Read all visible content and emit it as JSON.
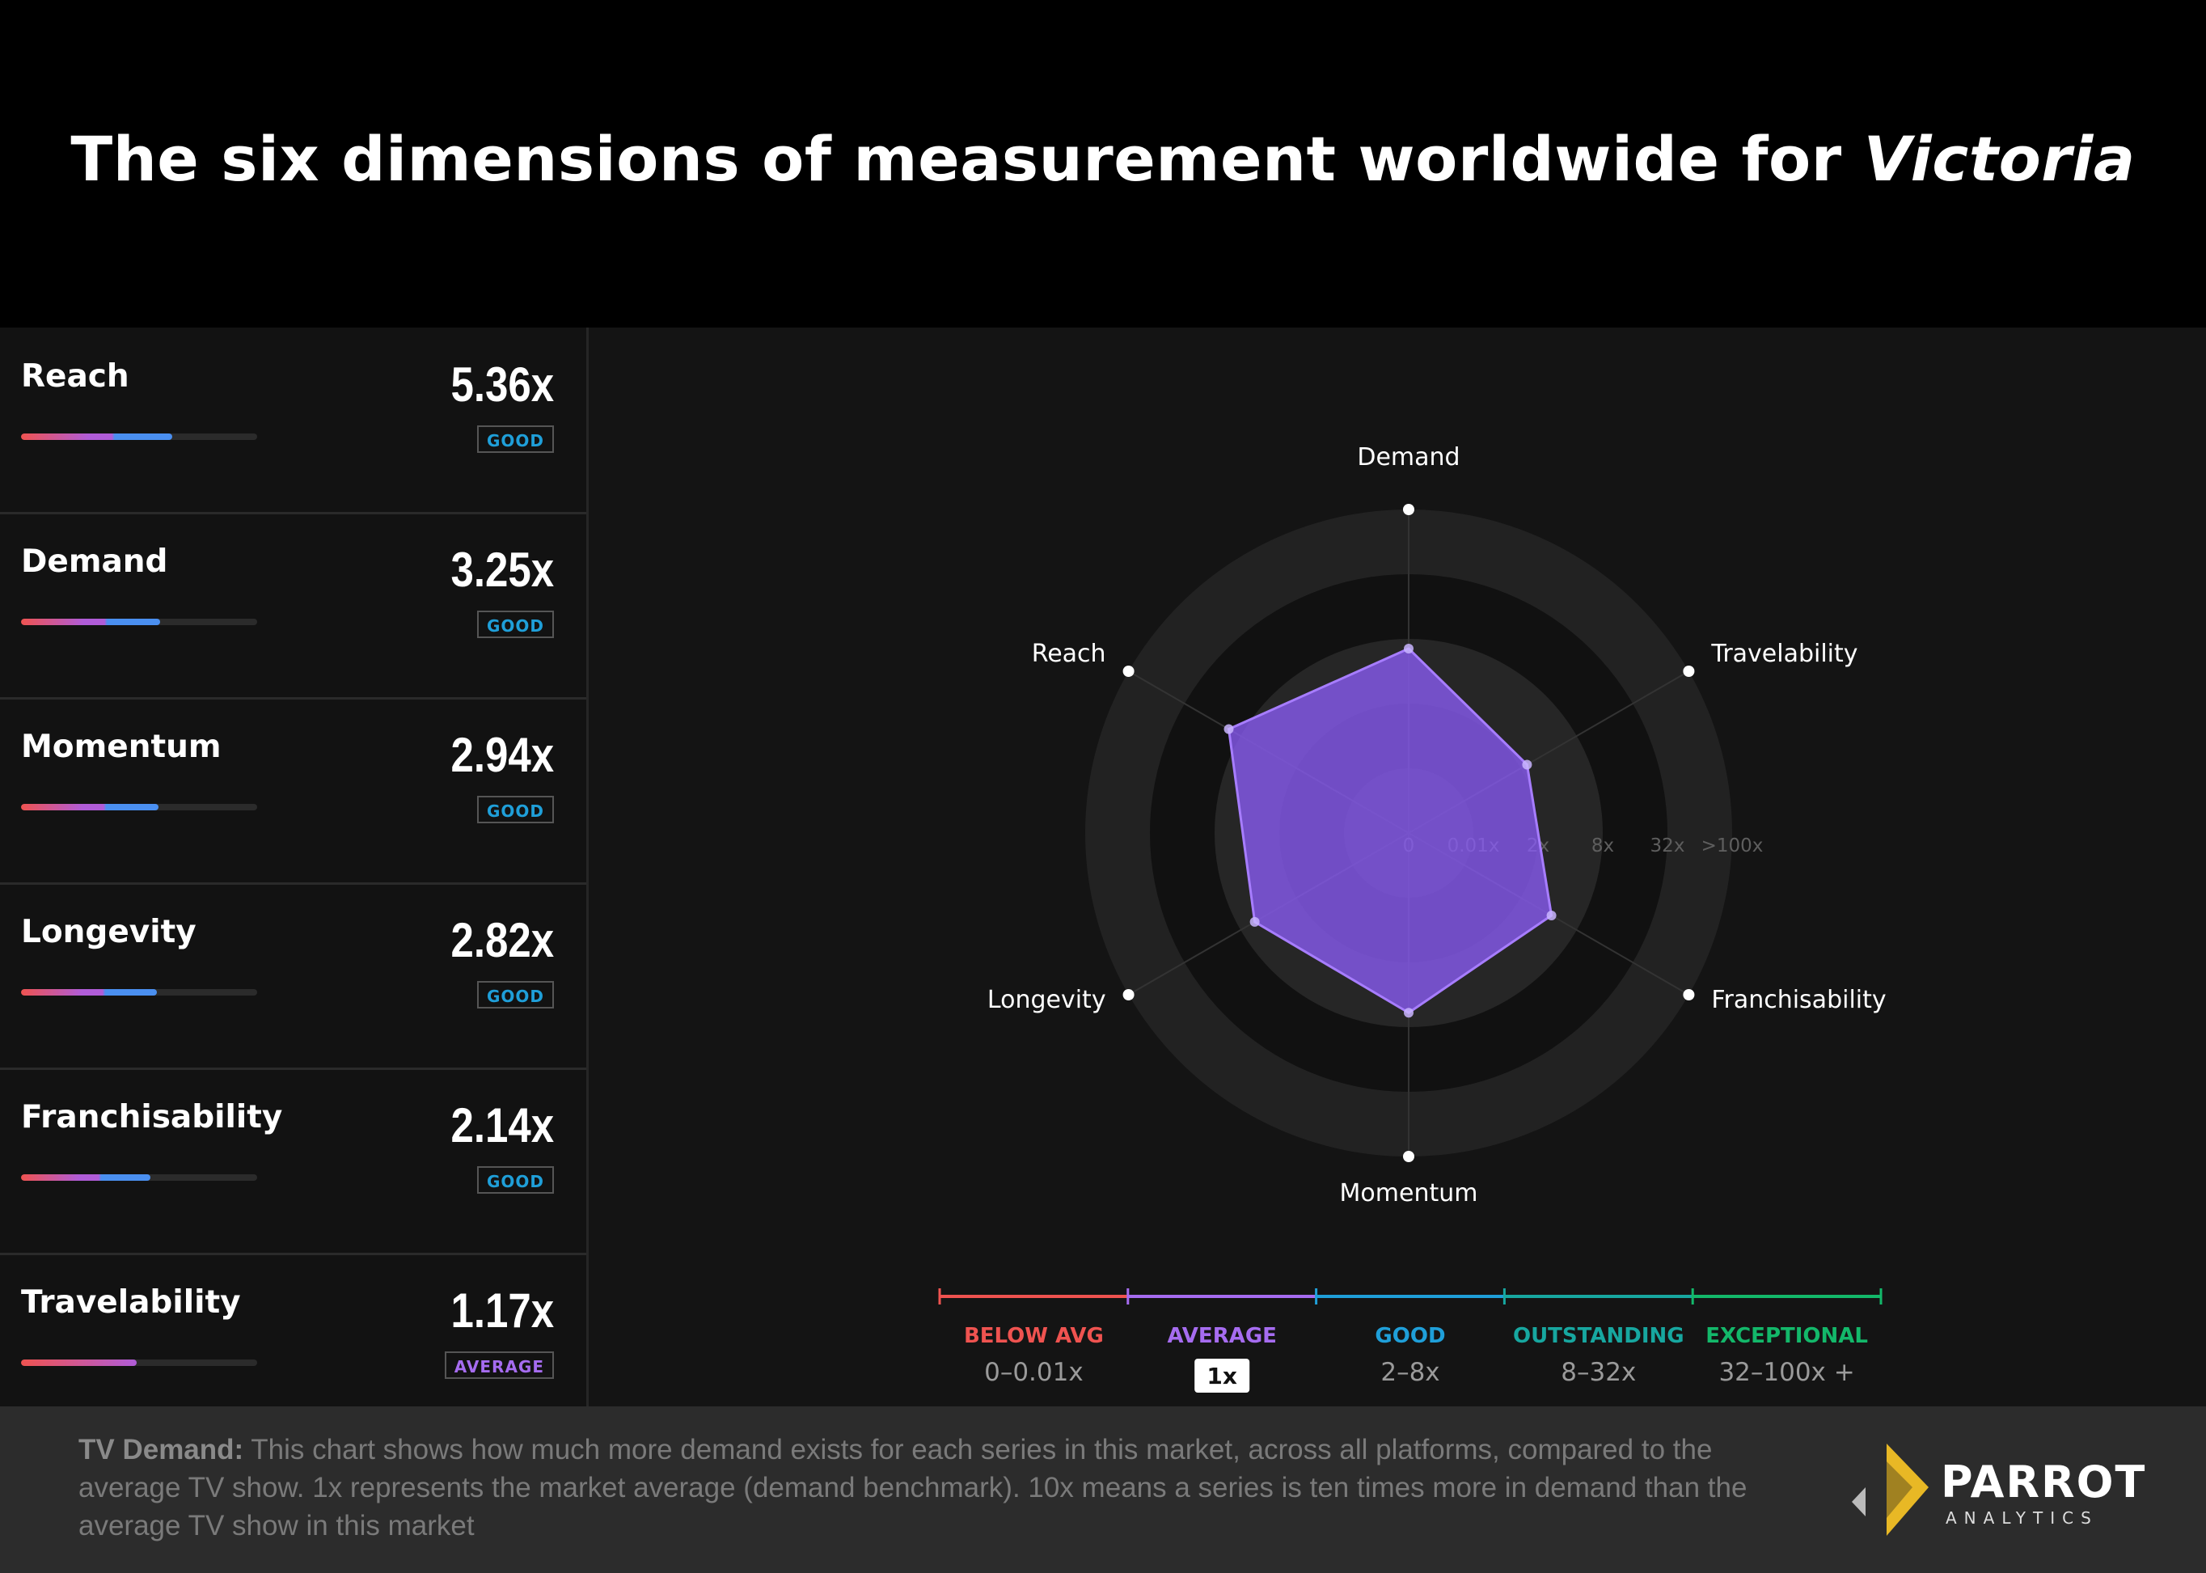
{
  "title": {
    "prefix": "The six dimensions of measurement worldwide for ",
    "show": "Victoria"
  },
  "metrics": [
    {
      "name": "Reach",
      "value": "5.36x",
      "badge": "GOOD"
    },
    {
      "name": "Demand",
      "value": "3.25x",
      "badge": "GOOD"
    },
    {
      "name": "Momentum",
      "value": "2.94x",
      "badge": "GOOD"
    },
    {
      "name": "Longevity",
      "value": "2.82x",
      "badge": "GOOD"
    },
    {
      "name": "Franchisability",
      "value": "2.14x",
      "badge": "GOOD"
    },
    {
      "name": "Travelability",
      "value": "1.17x",
      "badge": "AVERAGE"
    }
  ],
  "chart_data": {
    "type": "radar",
    "axes": [
      "Demand",
      "Travelability",
      "Franchisability",
      "Momentum",
      "Longevity",
      "Reach"
    ],
    "values": [
      3.25,
      1.17,
      2.14,
      2.94,
      2.82,
      5.36
    ],
    "scale_ticks": [
      "0",
      "0.01x",
      "2x",
      "8x",
      "32x",
      ">100x"
    ],
    "scale_type": "log",
    "fill_color": "#8b5cf6",
    "legend": [
      {
        "label": "BELOW AVG",
        "range": "0–0.01x",
        "color": "#ef5350"
      },
      {
        "label": "AVERAGE",
        "range": "1x",
        "color": "#a66cf0"
      },
      {
        "label": "GOOD",
        "range": "2–8x",
        "color": "#1f9fd9"
      },
      {
        "label": "OUTSTANDING",
        "range": "8–32x",
        "color": "#17a7a0"
      },
      {
        "label": "EXCEPTIONAL",
        "range": "32–100x +",
        "color": "#13b86a"
      }
    ]
  },
  "footer": {
    "lead": "TV Demand:",
    "text": " This chart shows how much more demand exists for each series in this market, across all platforms, compared to the average TV show. 1x represents the market average (demand benchmark). 10x means a series is ten times more in demand than the average TV show in this market"
  },
  "logo": {
    "word": "PARROT",
    "sub": "ANALYTICS"
  },
  "colors": {
    "good": "#1f9fd9",
    "average": "#a66cf0",
    "below": "#ef5350",
    "bar_blue": "#4a8ff0",
    "bar_purple": "#b05cd8"
  }
}
